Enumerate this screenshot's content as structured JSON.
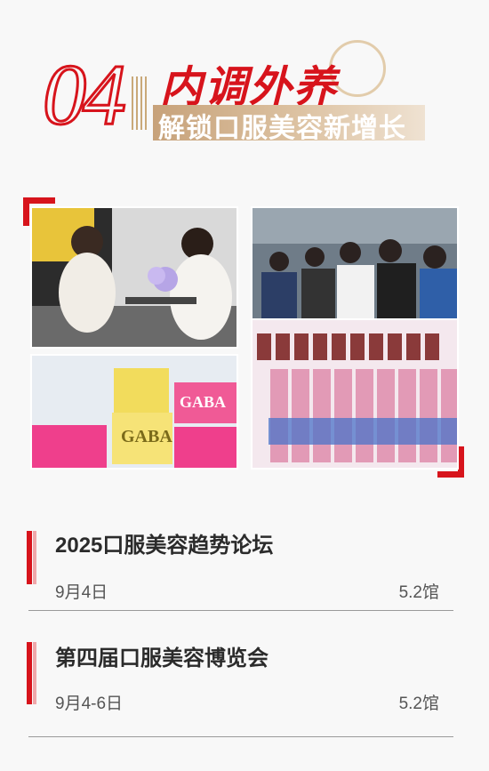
{
  "header": {
    "number": "04",
    "title": "内调外养",
    "subtitle": "解锁口服美容新增长"
  },
  "photos": {
    "top_left": {
      "description_icon": "meeting-photo"
    },
    "top_right": {
      "description_icon": "audience-photo"
    },
    "bottom_left": {
      "brand_text": "GABA",
      "brand_text_2": "GABA"
    },
    "bottom_right": {
      "description_icon": "bottles-photo"
    }
  },
  "events": [
    {
      "title": "2025口服美容趋势论坛",
      "date": "9月4日",
      "hall": "5.2馆"
    },
    {
      "title": "第四届口服美容博览会",
      "date": "9月4-6日",
      "hall": "5.2馆"
    }
  ],
  "colors": {
    "accent": "#d7141c",
    "gold": "#c7a27a"
  }
}
